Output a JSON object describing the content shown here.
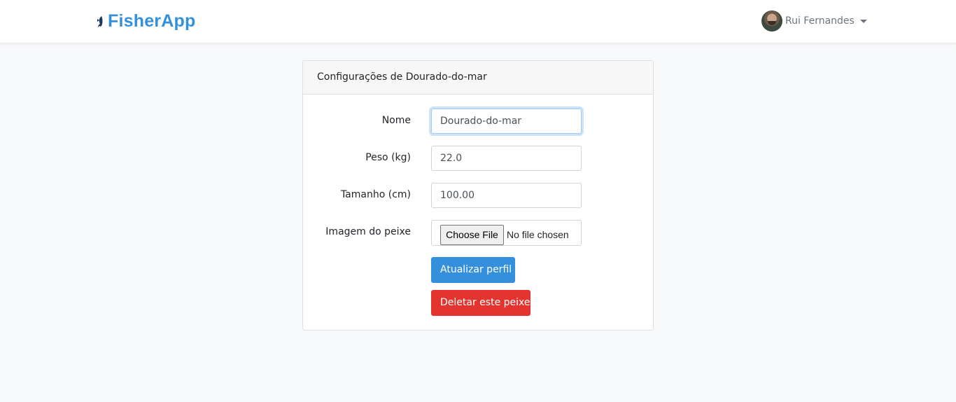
{
  "navbar": {
    "brand_part1": "Fisher",
    "brand_part2": "App",
    "logo_icon": "fish-icon",
    "user_name": "Rui Fernandes"
  },
  "card": {
    "header": "Configurações de Dourado-do-mar",
    "fields": {
      "nome": {
        "label": "Nome",
        "value": "Dourado-do-mar"
      },
      "peso": {
        "label": "Peso (kg)",
        "value": "22.0"
      },
      "tamanho": {
        "label": "Tamanho (cm)",
        "value": "100.00"
      },
      "imagem": {
        "label": "Imagem do peixe",
        "button": "Choose File",
        "status": "No file chosen"
      }
    },
    "update_button": "Atualizar perfil",
    "delete_button": "Deletar este peixe"
  },
  "colors": {
    "brand": "#3490dc",
    "primary": "#3490dc",
    "danger": "#e3342f"
  }
}
